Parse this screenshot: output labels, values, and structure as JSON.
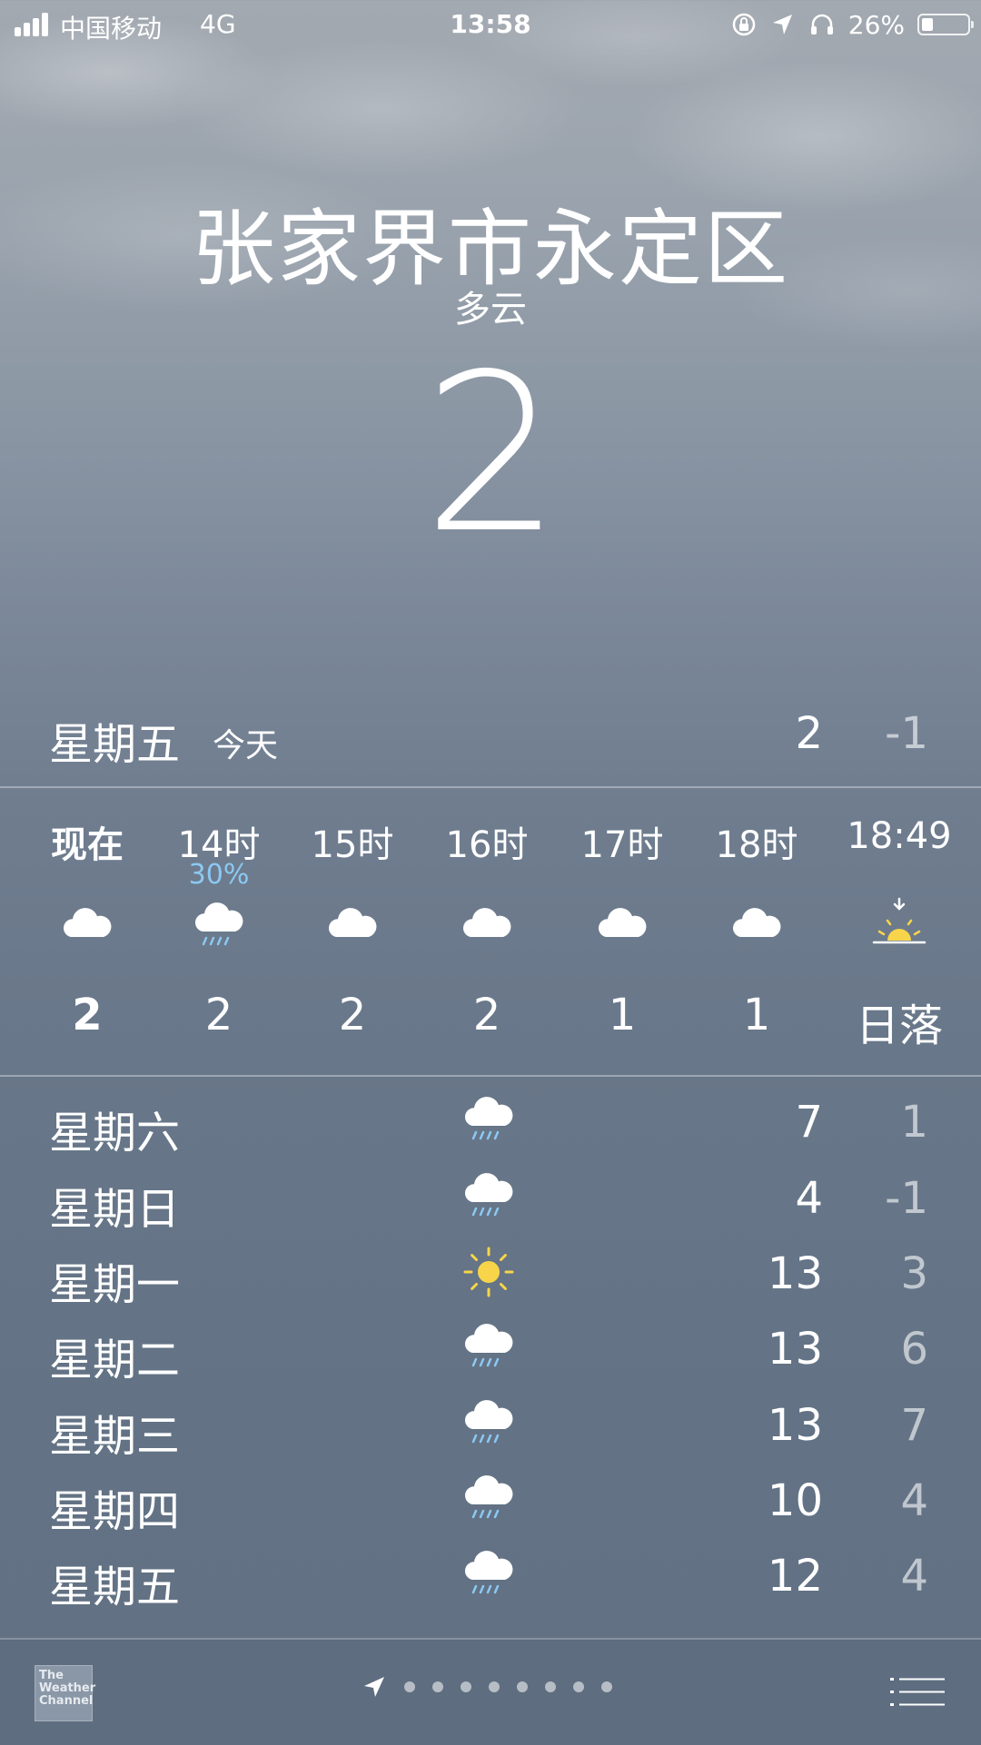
{
  "status_bar": {
    "carrier": "中国移动",
    "network": "4G",
    "time": "13:58",
    "battery_percent": "26%",
    "battery_level": 0.26
  },
  "location": {
    "city": "张家界市永定区",
    "condition": "多云",
    "temperature": "2"
  },
  "today": {
    "day": "星期五",
    "label": "今天",
    "high": "2",
    "low": "-1"
  },
  "hourly": [
    {
      "time": "现在",
      "icon": "cloud-icon",
      "temp": "2"
    },
    {
      "time": "14时",
      "precip": "30%",
      "icon": "cloud-rain-icon",
      "temp": "2"
    },
    {
      "time": "15时",
      "icon": "cloud-icon",
      "temp": "2"
    },
    {
      "time": "16时",
      "icon": "cloud-icon",
      "temp": "2"
    },
    {
      "time": "17时",
      "icon": "cloud-icon",
      "temp": "1"
    },
    {
      "time": "18时",
      "icon": "cloud-icon",
      "temp": "1"
    },
    {
      "time": "18:49",
      "icon": "sunset-icon",
      "temp": "日落"
    }
  ],
  "daily": [
    {
      "day": "星期六",
      "icon": "cloud-rain-icon",
      "high": "7",
      "low": "1"
    },
    {
      "day": "星期日",
      "icon": "cloud-rain-icon",
      "high": "4",
      "low": "-1"
    },
    {
      "day": "星期一",
      "icon": "sun-icon",
      "high": "13",
      "low": "3"
    },
    {
      "day": "星期二",
      "icon": "cloud-rain-icon",
      "high": "13",
      "low": "6"
    },
    {
      "day": "星期三",
      "icon": "cloud-rain-icon",
      "high": "13",
      "low": "7"
    },
    {
      "day": "星期四",
      "icon": "cloud-rain-icon",
      "high": "10",
      "low": "4"
    },
    {
      "day": "星期五",
      "icon": "cloud-rain-icon",
      "high": "12",
      "low": "4"
    }
  ],
  "bottom_bar": {
    "logo_text": "The Weather Channel",
    "page_count": 8
  },
  "colors": {
    "precip_blue": "#8cc8f2",
    "sun_yellow": "#f7d44a"
  }
}
